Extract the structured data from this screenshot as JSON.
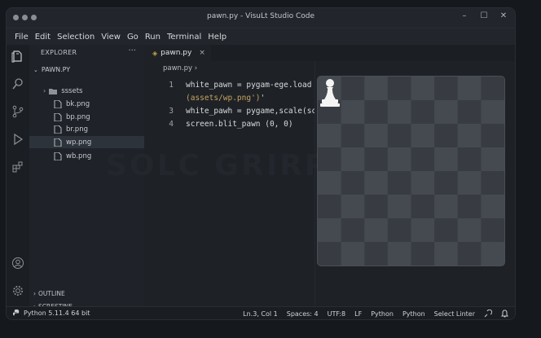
{
  "window": {
    "title": "pawn.py - VisuLt Studio Code"
  },
  "menu": [
    "File",
    "Edit",
    "Selection",
    "View",
    "Go",
    "Run",
    "Terminal",
    "Help"
  ],
  "sidebar": {
    "header": "EXPLORER",
    "more": "···",
    "folder": "PAWN.PY",
    "items": [
      {
        "name": "sssets",
        "type": "folder"
      },
      {
        "name": "bk.png",
        "type": "file"
      },
      {
        "name": "bp.png",
        "type": "file"
      },
      {
        "name": "br.png",
        "type": "file"
      },
      {
        "name": "wp.png",
        "type": "file",
        "selected": true
      },
      {
        "name": "wb.png",
        "type": "file"
      }
    ],
    "sections": [
      "OUTLINE",
      "SCRESTINE"
    ]
  },
  "editor": {
    "tab": {
      "label": "pawn.py",
      "close": "×"
    },
    "breadcrumb": "pawn.py  ›",
    "lines": [
      {
        "num": "1",
        "parts": [
          {
            "t": "white_pawn = pygam-ege.load",
            "c": "plain"
          }
        ]
      },
      {
        "num": "",
        "parts": [
          {
            "t": "(assets/wp.png')",
            "c": "str"
          },
          {
            "t": "'",
            "c": "plain"
          }
        ]
      },
      {
        "num": "3",
        "parts": [
          {
            "t": "white_pawh = pygame,scale(sc",
            "c": "plain"
          }
        ]
      },
      {
        "num": "4",
        "parts": [
          {
            "t": "screen.blit_pawn  (0, 0)",
            "c": "plain"
          }
        ]
      }
    ],
    "watermark": "SOLC GRIRP"
  },
  "board": {
    "rows": 8,
    "cols": 8,
    "light": "#454a50",
    "dark": "#383c42",
    "pawn_square": [
      0,
      0
    ]
  },
  "statusbar": {
    "left": "Python 5.11.4 64 bit",
    "right": [
      "Ln.3, Col 1",
      "Spaces: 4",
      "UTF:8",
      "LF",
      "Python",
      "Python",
      "Select Linter"
    ]
  },
  "colors": {
    "accent_string": "#c9a25d",
    "python_icon": "#c5a54a"
  }
}
